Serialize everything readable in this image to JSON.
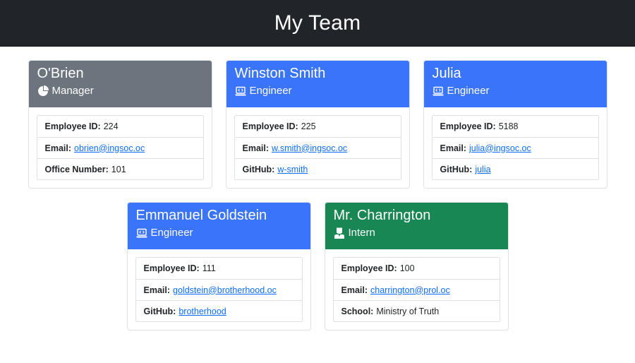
{
  "page": {
    "title": "My Team"
  },
  "colors": {
    "navbar": "#212529",
    "manager_header": "#6c757d",
    "engineer_header": "#3a74fb",
    "intern_header": "#198754",
    "link": "#0d6efd"
  },
  "cards": [
    {
      "name": "O'Brien",
      "role": "Manager",
      "icon": "pie-chart-icon",
      "details": [
        {
          "label": "Employee ID:",
          "value": "224"
        },
        {
          "label": "Email:",
          "value": "obrien@ingsoc.oc"
        },
        {
          "label": "Office Number:",
          "value": "101"
        }
      ]
    },
    {
      "name": "Winston Smith",
      "role": "Engineer",
      "icon": "laptop-code-icon",
      "details": [
        {
          "label": "Employee ID:",
          "value": "225"
        },
        {
          "label": "Email:",
          "value": "w.smith@ingsoc.oc"
        },
        {
          "label": "GitHub:",
          "value": "w-smith"
        }
      ]
    },
    {
      "name": "Julia",
      "role": "Engineer",
      "icon": "laptop-code-icon",
      "details": [
        {
          "label": "Employee ID:",
          "value": "5188"
        },
        {
          "label": "Email:",
          "value": "julia@ingsoc.oc"
        },
        {
          "label": "GitHub:",
          "value": "julia"
        }
      ]
    },
    {
      "name": "Emmanuel Goldstein",
      "role": "Engineer",
      "icon": "laptop-code-icon",
      "details": [
        {
          "label": "Employee ID:",
          "value": "111"
        },
        {
          "label": "Email:",
          "value": "goldstein@brotherhood.oc"
        },
        {
          "label": "GitHub:",
          "value": "brotherhood"
        }
      ]
    },
    {
      "name": "Mr. Charrington",
      "role": "Intern",
      "icon": "graduate-icon",
      "details": [
        {
          "label": "Employee ID:",
          "value": "100"
        },
        {
          "label": "Email:",
          "value": "charrington@prol.oc"
        },
        {
          "label": "School:",
          "value": "Ministry of Truth"
        }
      ]
    }
  ]
}
